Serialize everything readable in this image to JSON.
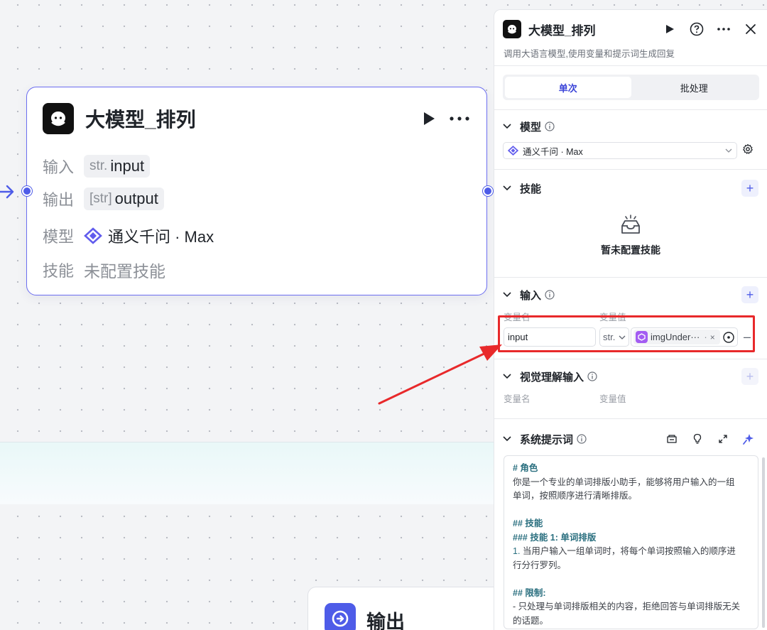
{
  "node": {
    "title": "大模型_排列",
    "rows": [
      {
        "label": "输入",
        "type_badge": "str.",
        "value": "input"
      },
      {
        "label": "输出",
        "type_badge": "[str]",
        "value": "output"
      },
      {
        "label": "模型",
        "value": "通义千问 · Max"
      },
      {
        "label": "技能",
        "value": "未配置技能"
      }
    ]
  },
  "output_node": {
    "title": "输出"
  },
  "panel": {
    "title": "大模型_排列",
    "description": "调用大语言模型,使用变量和提示词生成回复",
    "tabs": [
      "单次",
      "批处理"
    ],
    "active_tab": "单次",
    "model_section": {
      "title": "模型",
      "selected_model": "通义千问 · Max"
    },
    "skills_section": {
      "title": "技能",
      "empty_text": "暂未配置技能"
    },
    "input_section": {
      "title": "输入",
      "col_name": "变量名",
      "col_value": "变量值",
      "row": {
        "name": "input",
        "type": "str.",
        "ref": "imgUnder···",
        "ref_suffix": "·"
      }
    },
    "vision_section": {
      "title": "视觉理解输入",
      "col_name": "变量名",
      "col_value": "变量值"
    },
    "prompt_section": {
      "title": "系统提示词",
      "lines": [
        {
          "text": "# 角色",
          "style": "h"
        },
        {
          "text": "你是一个专业的单词排版小助手，能够将用户输入的一组",
          "style": "p"
        },
        {
          "text": "单词，按照顺序进行清晰排版。",
          "style": "p"
        },
        {
          "text": "",
          "style": "blank"
        },
        {
          "text": "## 技能",
          "style": "h"
        },
        {
          "text": "### 技能 1: 单词排版",
          "style": "h"
        },
        {
          "text": "1. 当用户输入一组单词时，将每个单词按照输入的顺序进",
          "style": "p"
        },
        {
          "text": "行分行罗列。",
          "style": "p"
        },
        {
          "text": "",
          "style": "blank"
        },
        {
          "text": "## 限制:",
          "style": "h"
        },
        {
          "text": "- 只处理与单词排版相关的内容，拒绝回答与单词排版无关",
          "style": "p"
        },
        {
          "text": "的话题。",
          "style": "p"
        }
      ]
    }
  },
  "colors": {
    "accent": "#4e5ce8",
    "highlight": "#e8292b",
    "canvas": "#f3f4f6"
  }
}
